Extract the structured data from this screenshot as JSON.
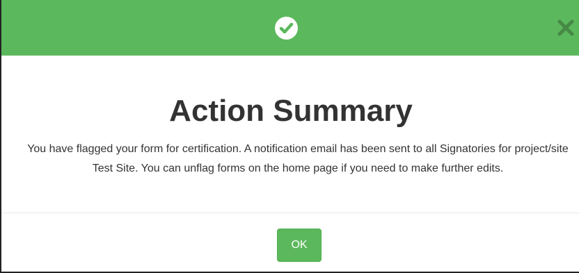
{
  "header": {
    "color": "#5cb85c",
    "status_icon": "check-circle-icon",
    "close_icon": "close-icon"
  },
  "dialog": {
    "title": "Action Summary",
    "message": "You have flagged your form for certification. A notification email has been sent to all Signatories for project/site Test Site. You can unflag forms on the home page if you need to make further edits."
  },
  "footer": {
    "ok_label": "OK"
  }
}
